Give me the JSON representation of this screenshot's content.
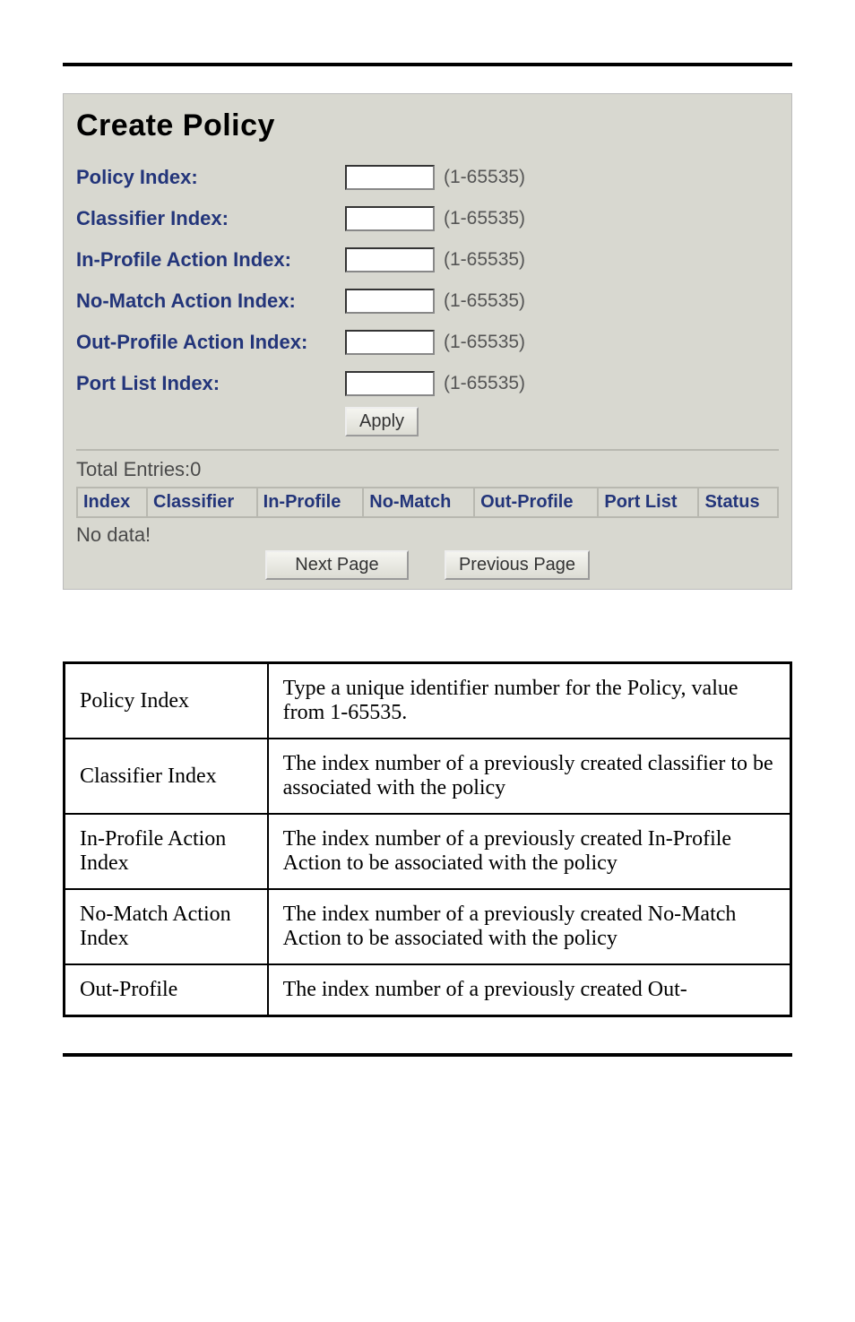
{
  "title": "Create Policy",
  "form": {
    "rows": [
      {
        "label": "Policy Index:",
        "value": "",
        "hint": "(1-65535)"
      },
      {
        "label": "Classifier Index:",
        "value": "",
        "hint": "(1-65535)"
      },
      {
        "label": "In-Profile Action Index:",
        "value": "",
        "hint": "(1-65535)"
      },
      {
        "label": "No-Match Action Index:",
        "value": "",
        "hint": "(1-65535)"
      },
      {
        "label": "Out-Profile Action Index:",
        "value": "",
        "hint": "(1-65535)"
      },
      {
        "label": "Port List Index:",
        "value": "",
        "hint": "(1-65535)"
      }
    ],
    "apply_label": "Apply"
  },
  "entries": {
    "total_label": "Total Entries:0",
    "headers": [
      "Index",
      "Classifier",
      "In-Profile",
      "No-Match",
      "Out-Profile",
      "Port List",
      "Status"
    ],
    "no_data_label": "No data!",
    "next_label": "Next Page",
    "prev_label": "Previous Page"
  },
  "descriptions": [
    {
      "term": "Policy Index",
      "def": "Type a unique identifier number for the Policy, value from 1-65535."
    },
    {
      "term": "Classifier Index",
      "def": "The index number of a previously created classifier to be associated with the policy"
    },
    {
      "term": "In-Profile Action Index",
      "def": "The index number of a previously created In-Profile Action to be associated with the policy"
    },
    {
      "term": "No-Match Action Index",
      "def": "The index number of a previously created No-Match Action to be associated with the policy"
    },
    {
      "term": "Out-Profile",
      "def": "The index number of a previously created Out-"
    }
  ]
}
